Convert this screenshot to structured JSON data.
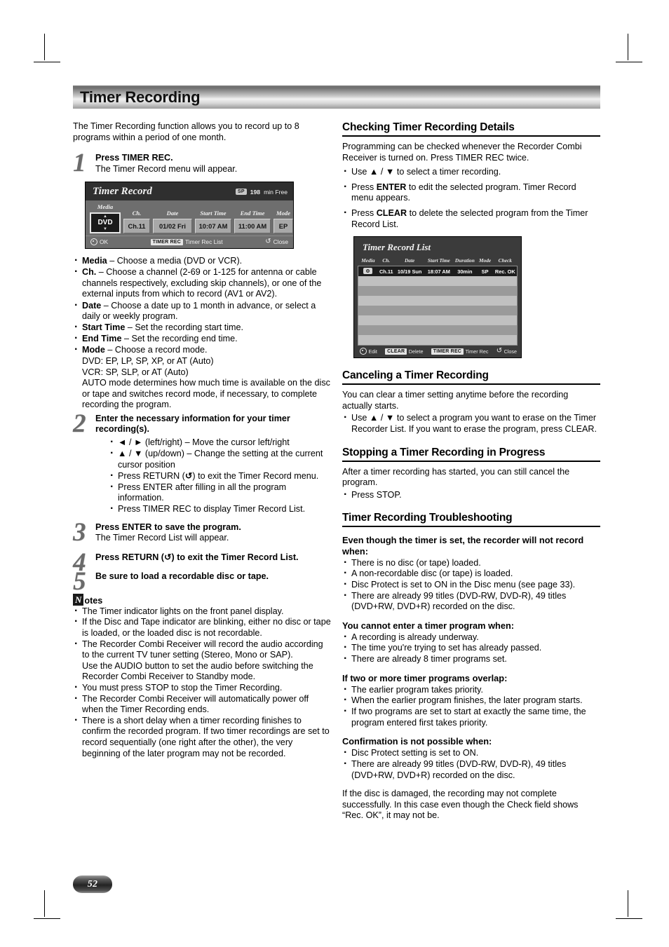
{
  "page": {
    "title": "Timer Recording",
    "number": "52"
  },
  "left": {
    "lead": "The Timer Recording function allows you to record up to 8 programs within a period of one month.",
    "steps": [
      {
        "num": "1",
        "title": "Press TIMER REC.",
        "body": "The Timer Record menu will appear."
      },
      {
        "num": "2",
        "title": "Enter the necessary information for your timer recording(s).",
        "bullets": [
          "◄ / ► (left/right) – Move the cursor left/right",
          "▲ / ▼ (up/down) – Change the setting at the current cursor position",
          "Press RETURN (\u0001) to exit the Timer Record menu.",
          "Press ENTER after filling in all the program information.",
          "Press TIMER REC to display Timer Record List."
        ]
      },
      {
        "num": "3",
        "title": "Press ENTER to save the program.",
        "body": "The Timer Record List will appear."
      },
      {
        "num": "4",
        "title": "Press RETURN (\u0001) to exit the Timer Record List."
      },
      {
        "num": "5",
        "title": "Be sure to load a recordable disc or tape."
      }
    ],
    "field_bullets": [
      {
        "term": "Media",
        "text": " – Choose a media (DVD or VCR)."
      },
      {
        "term": "Ch.",
        "text": " – Choose a channel (2-69 or 1-125 for antenna or cable channels respectively, excluding skip channels), or one of the external inputs from which to record (AV1 or AV2)."
      },
      {
        "term": "Date",
        "text": " – Choose a date up to 1 month in advance, or select a daily or weekly program."
      },
      {
        "term": "Start Time",
        "text": " – Set the recording start time."
      },
      {
        "term": "End Time",
        "text": " – Set the recording end time."
      },
      {
        "term": "Mode",
        "text": " – Choose a record mode."
      }
    ],
    "mode_lines": [
      "DVD: EP, LP, SP, XP, or AT (Auto)",
      "VCR: SP, SLP, or AT (Auto)",
      "AUTO mode determines how much time is available on the disc or tape and switches record mode, if necessary, to complete recording the program."
    ],
    "notes": {
      "badge_letter": "N",
      "heading_rest": "otes",
      "items": [
        "The Timer indicator lights on the front panel display.",
        "If the Disc and Tape indicator are blinking, either no disc or tape is loaded, or the loaded disc is not recordable.",
        "The Recorder Combi Receiver will record the audio according to the current TV tuner setting (Stereo, Mono or SAP).\nUse the AUDIO button to set the audio before switching the Recorder Combi Receiver to Standby mode.",
        "You must press STOP to stop the Timer Recording.",
        "The Recorder Combi Receiver will automatically power off when the Timer Recording ends.",
        "There is a short delay when a timer recording finishes to confirm the recorded program. If two timer recordings are set to record sequentially (one right after the other), the very beginning of the later program may not be recorded."
      ]
    }
  },
  "timer_record_menu": {
    "title": "Timer Record",
    "mode_chip": "SP",
    "free_value": "198",
    "free_unit": "min Free",
    "columns": [
      "Media",
      "Ch.",
      "Date",
      "Start Time",
      "End Time",
      "Mode"
    ],
    "values": {
      "media": "DVD",
      "ch": "Ch.11",
      "date": "01/02 Fri",
      "start_time": "10:07 AM",
      "end_time": "11:00 AM",
      "mode": "EP"
    },
    "footer": {
      "ok": "OK",
      "timer_rec_key": "TIMER REC",
      "timer_rec_label": "Timer Rec List",
      "close": "Close"
    }
  },
  "timer_record_list": {
    "title": "Timer Record List",
    "columns": [
      "Media",
      "Ch.",
      "Date",
      "Start Time",
      "Duration",
      "Mode",
      "Check"
    ],
    "rows": [
      {
        "media": "disc-icon",
        "ch": "Ch.11",
        "date": "10/19 Sun",
        "start_time": "18:07 AM",
        "duration": "30min",
        "mode": "SP",
        "check": "Rec. OK"
      }
    ],
    "empty_row_count": 7,
    "footer": {
      "edit": "Edit",
      "clear_key": "CLEAR",
      "delete": "Delete",
      "timer_rec_key": "TIMER REC",
      "timer_rec": "Timer Rec",
      "close": "Close"
    }
  },
  "right": {
    "checking": {
      "heading": "Checking Timer Recording Details",
      "body": "Programming can be checked whenever the Recorder Combi Receiver is turned on. Press TIMER REC twice.",
      "bullets": [
        {
          "pre": "Use ▲ / ▼ to select a timer recording.",
          "bold": "",
          "post": ""
        },
        {
          "pre": "Press ",
          "bold": "ENTER",
          "post": " to edit the selected program. Timer Record menu appears."
        },
        {
          "pre": "Press ",
          "bold": "CLEAR",
          "post": " to delete the selected program from the Timer Record List."
        }
      ]
    },
    "canceling": {
      "heading": "Canceling a Timer Recording",
      "body": "You can clear a timer setting anytime before the recording actually starts.",
      "bullets": [
        "Use ▲ / ▼ to select a program you want to erase on the Timer Recorder List. If you want to erase the program, press CLEAR."
      ]
    },
    "stopping": {
      "heading": "Stopping a Timer Recording in Progress",
      "body": "After a timer recording has started, you can still cancel the program.",
      "bullets": [
        "Press STOP."
      ]
    },
    "troubleshooting": {
      "heading": "Timer Recording Troubleshooting",
      "groups": [
        {
          "subheading": "Even though the timer is set, the recorder will not record when:",
          "items": [
            "There is no disc (or tape) loaded.",
            "A non-recordable disc (or tape) is loaded.",
            "Disc Protect is set to ON in the Disc menu (see page 33).",
            "There are already 99 titles (DVD-RW, DVD-R), 49 titles (DVD+RW, DVD+R) recorded on the disc."
          ]
        },
        {
          "subheading": "You cannot enter a timer program when:",
          "items": [
            "A recording is already underway.",
            "The time you're trying to set has already passed.",
            "There are already 8 timer programs set."
          ]
        },
        {
          "subheading": "If two or more timer programs overlap:",
          "items": [
            "The earlier program takes priority.",
            "When the earlier program finishes, the later program starts.",
            "If two programs are set to start at exactly the same time, the program entered first takes priority."
          ]
        },
        {
          "subheading": "Confirmation is not possible when:",
          "items": [
            "Disc Protect setting is set to ON.",
            "There are already 99 titles (DVD-RW, DVD-R), 49 titles (DVD+RW, DVD+R) recorded on the disc."
          ]
        }
      ],
      "closing": "If the disc is damaged, the recording may not complete successfully. In this case even though the Check field shows “Rec. OK”, it may not be."
    }
  }
}
